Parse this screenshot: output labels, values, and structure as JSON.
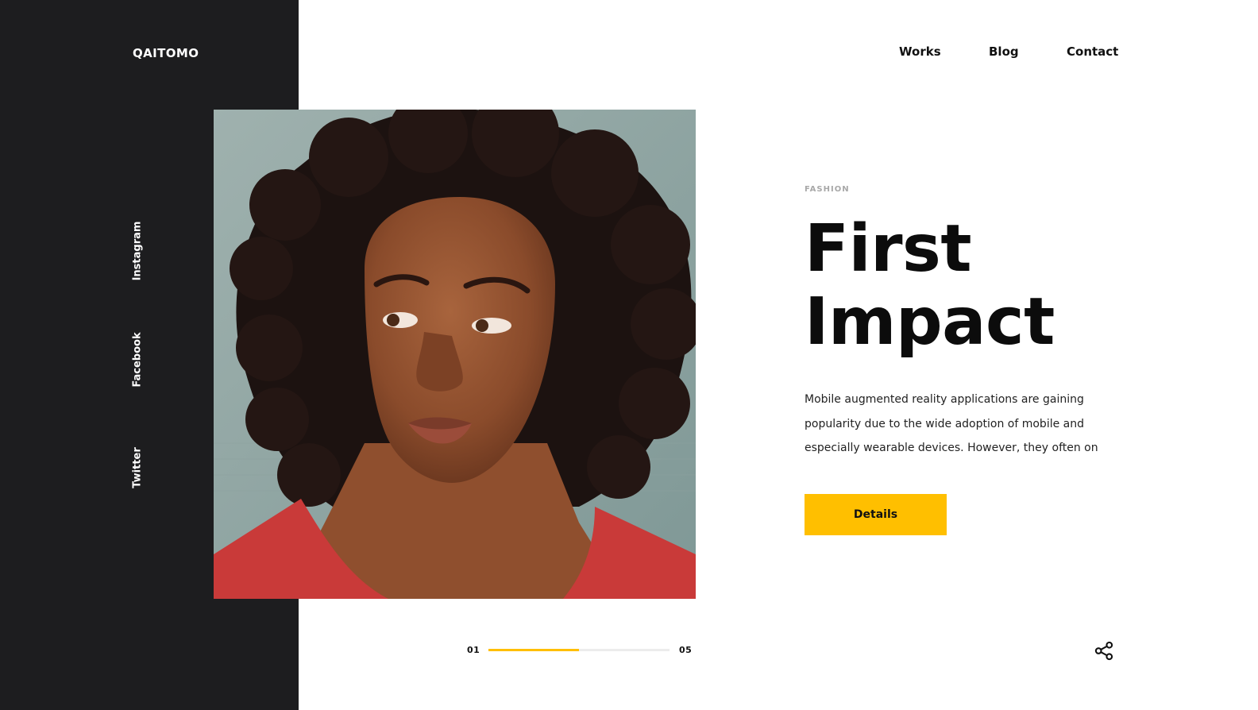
{
  "brand": {
    "logo": "QAITOMO"
  },
  "nav": {
    "items": [
      "Works",
      "Blog",
      "Contact"
    ]
  },
  "social": {
    "items": [
      "Instagram",
      "Facebook",
      "Twitter"
    ]
  },
  "hero": {
    "image_alt": "Portrait of a woman with curly hair in a red top"
  },
  "article": {
    "category": "FASHION",
    "title_line1": "First",
    "title_line2": "Impact",
    "description": "Mobile augmented reality applications are gaining popularity due to the wide adoption of mobile and especially wearable devices. However, they often on",
    "button_label": "Details"
  },
  "pager": {
    "current": "01",
    "total": "05",
    "progress": 0.5
  },
  "icons": {
    "share": "share-icon"
  },
  "colors": {
    "sidebar": "#1d1d1f",
    "accent": "#ffbf00",
    "text": "#111111"
  }
}
